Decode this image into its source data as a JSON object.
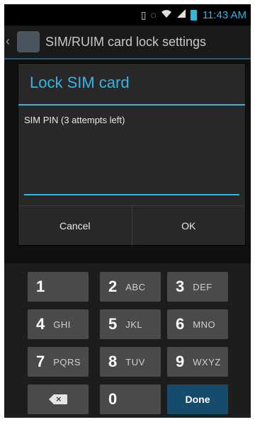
{
  "status_bar": {
    "time": "11:43 AM",
    "icons": [
      "vibrate-icon",
      "sync-icon",
      "wifi-icon",
      "signal-icon",
      "battery-icon"
    ]
  },
  "action_bar": {
    "title": "SIM/RUIM card lock settings"
  },
  "dialog": {
    "title": "Lock SIM card",
    "field_label": "SIM PIN (3 attempts left)",
    "field_value": "",
    "cancel_label": "Cancel",
    "ok_label": "OK"
  },
  "keypad": {
    "keys": [
      {
        "num": "1",
        "letters": ""
      },
      {
        "num": "2",
        "letters": "ABC"
      },
      {
        "num": "3",
        "letters": "DEF"
      },
      {
        "num": "4",
        "letters": "GHI"
      },
      {
        "num": "5",
        "letters": "JKL"
      },
      {
        "num": "6",
        "letters": "MNO"
      },
      {
        "num": "7",
        "letters": "PQRS"
      },
      {
        "num": "8",
        "letters": "TUV"
      },
      {
        "num": "9",
        "letters": "WXYZ"
      },
      {
        "num": "0",
        "letters": ""
      }
    ],
    "done_label": "Done"
  },
  "colors": {
    "accent": "#33b5e5",
    "done_key": "#164b6c"
  }
}
